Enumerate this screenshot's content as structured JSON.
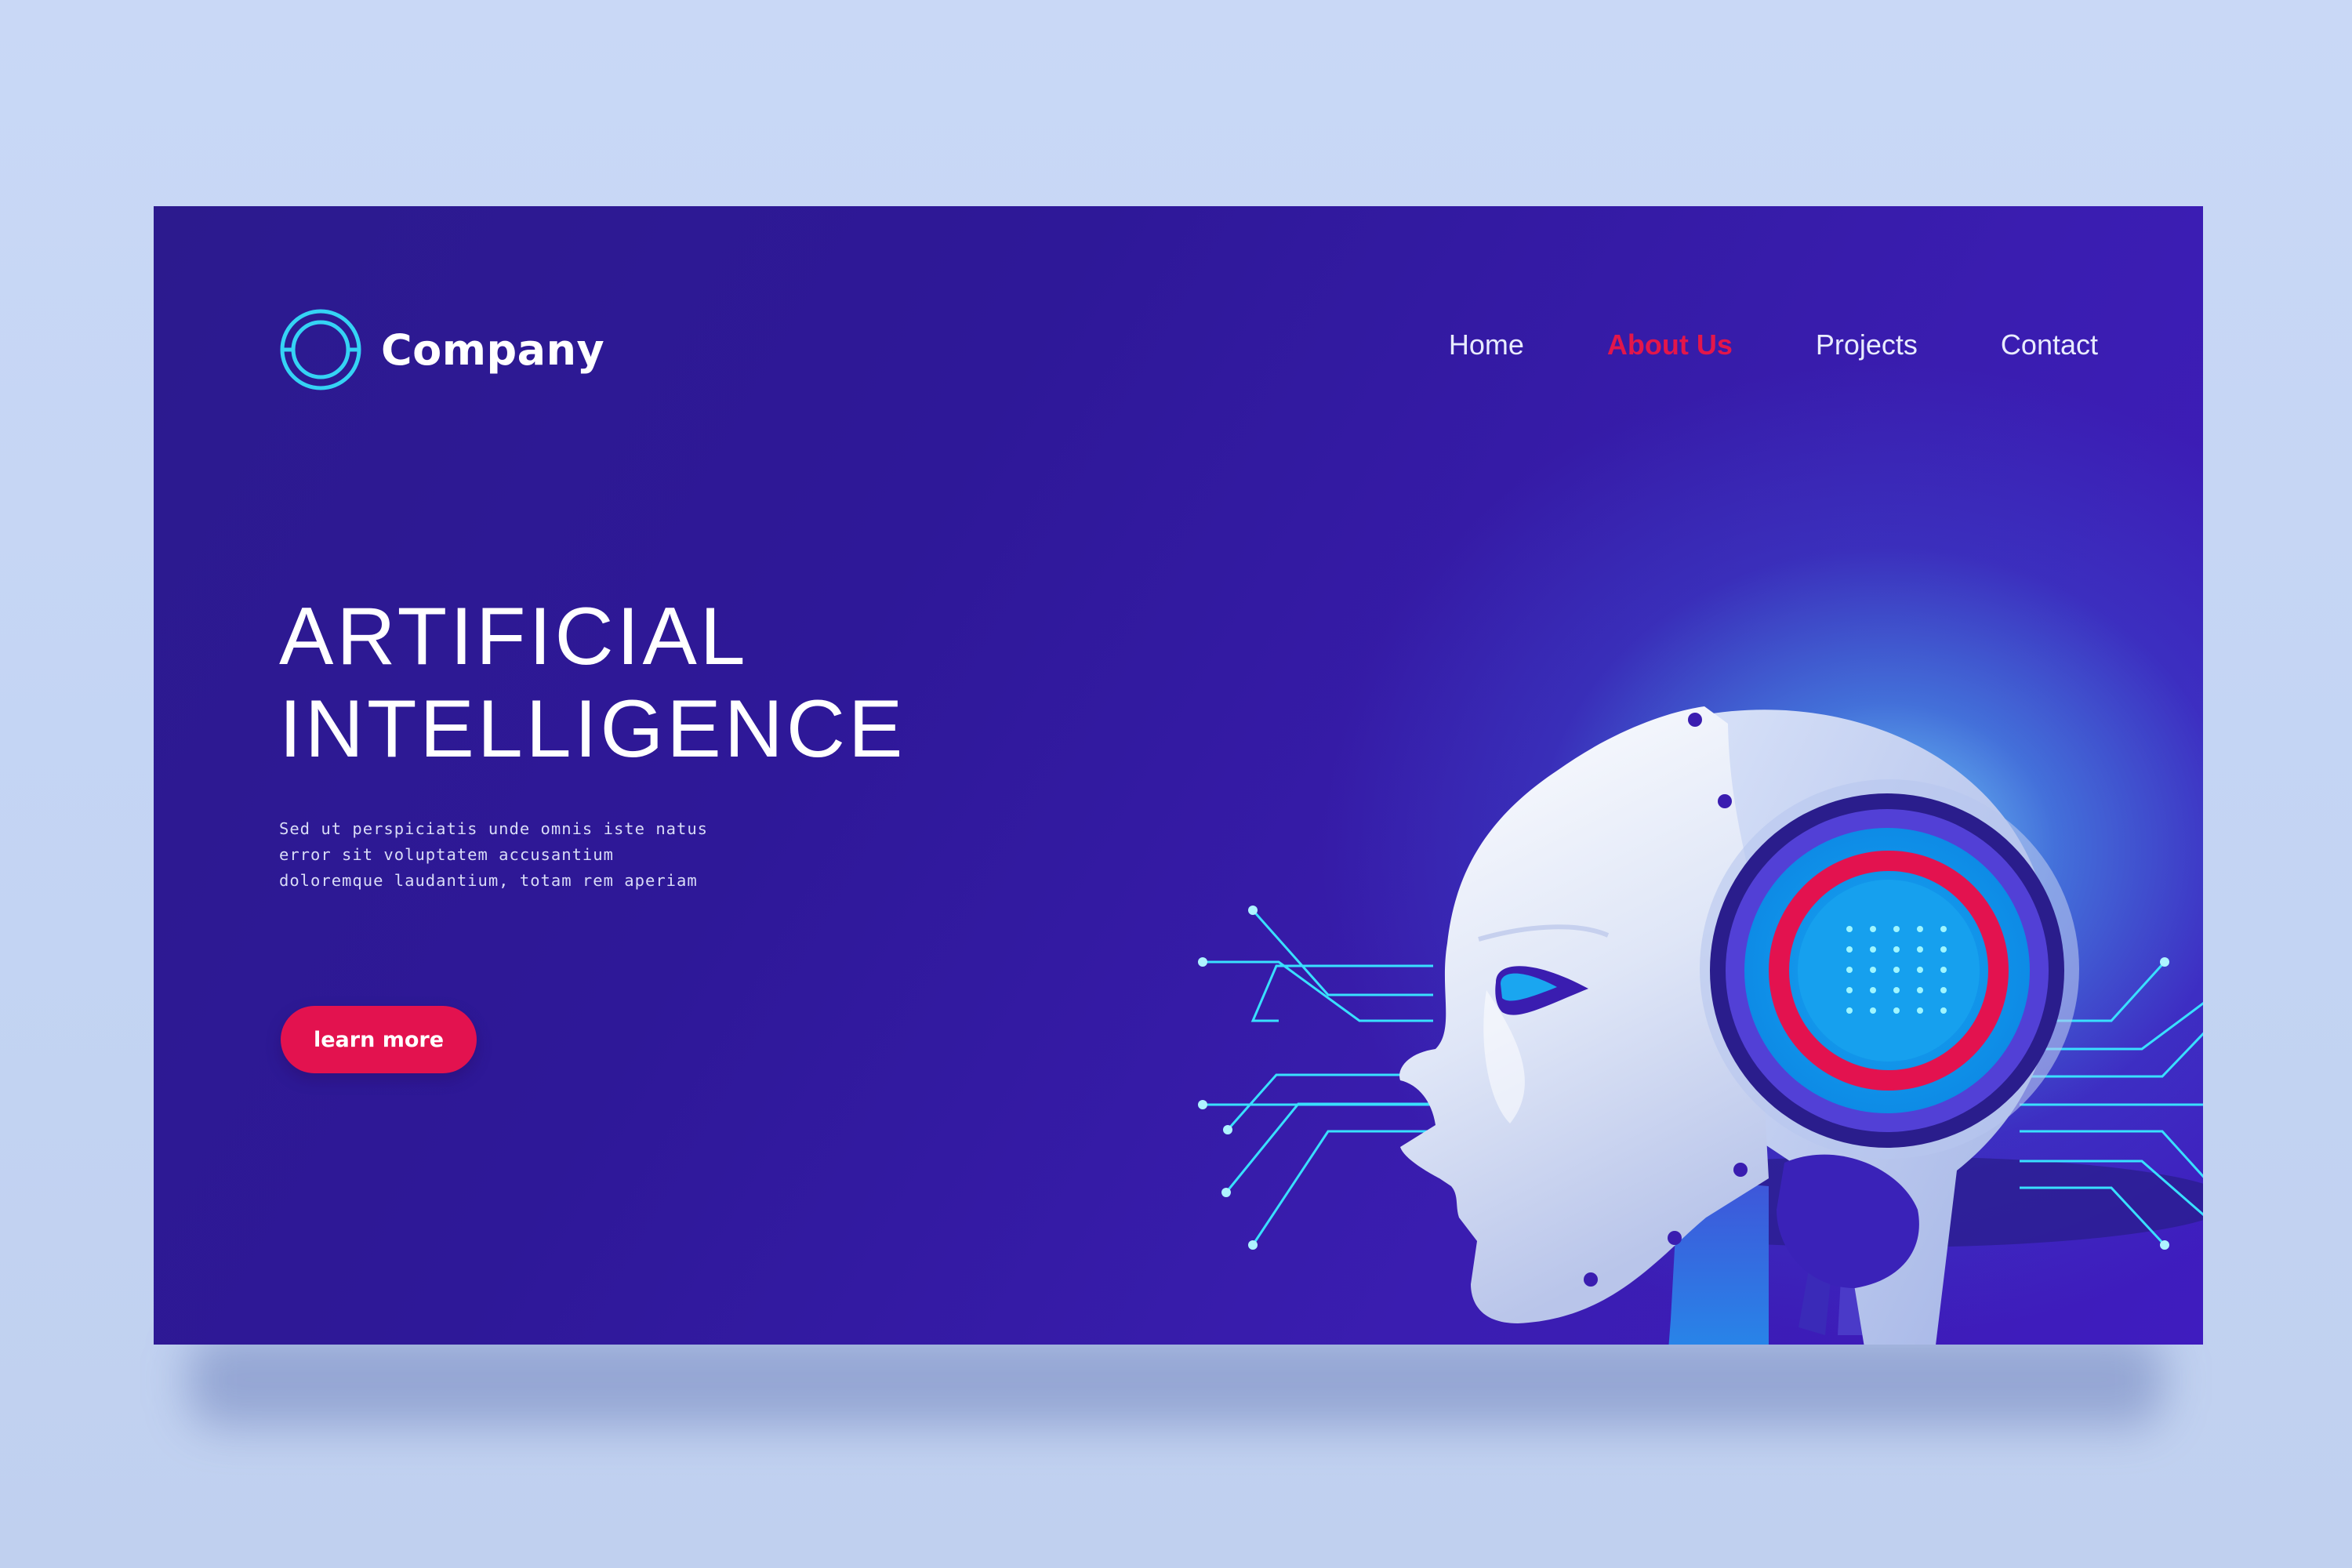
{
  "brand": {
    "name": "Company",
    "icon": "ring-logo-icon"
  },
  "nav": {
    "items": [
      {
        "label": "Home",
        "active": false
      },
      {
        "label": "About Us",
        "active": true
      },
      {
        "label": "Projects",
        "active": false
      },
      {
        "label": "Contact",
        "active": false
      }
    ]
  },
  "hero": {
    "title_line1": "ARTIFICIAL",
    "title_line2": "INTELLIGENCE",
    "desc_line1": "Sed ut perspiciatis unde omnis iste natus",
    "desc_line2": "error sit voluptatem accusantium",
    "desc_line3": "doloremque laudantium, totam rem aperiam",
    "cta_label": "learn more"
  },
  "colors": {
    "accent": "#e3124f",
    "background": "#2e1898",
    "page_background": "#c9d8f6",
    "circuit": "#39e0ff"
  },
  "illustration": {
    "icon": "robot-head-icon"
  }
}
